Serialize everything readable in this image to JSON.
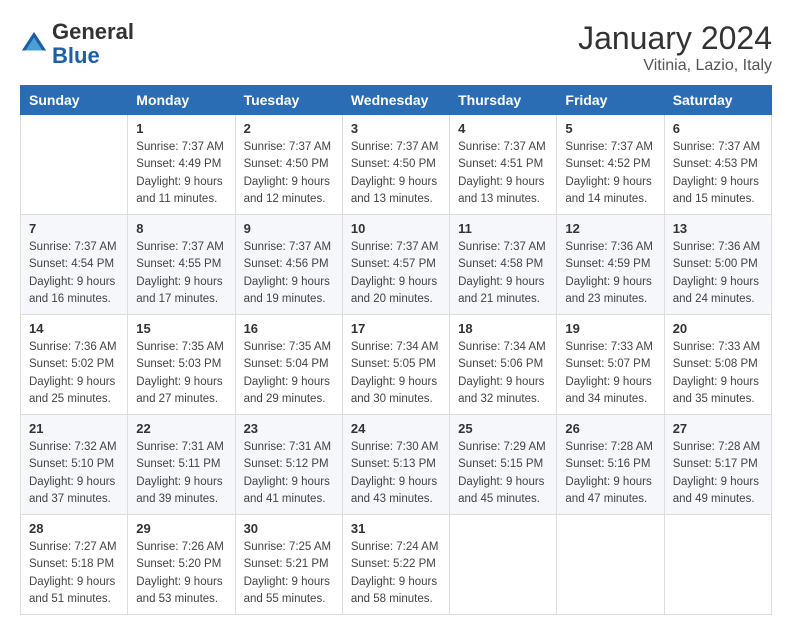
{
  "logo": {
    "general": "General",
    "blue": "Blue"
  },
  "title": "January 2024",
  "location": "Vitinia, Lazio, Italy",
  "days_of_week": [
    "Sunday",
    "Monday",
    "Tuesday",
    "Wednesday",
    "Thursday",
    "Friday",
    "Saturday"
  ],
  "weeks": [
    [
      {
        "day": "",
        "info": ""
      },
      {
        "day": "1",
        "info": "Sunrise: 7:37 AM\nSunset: 4:49 PM\nDaylight: 9 hours\nand 11 minutes."
      },
      {
        "day": "2",
        "info": "Sunrise: 7:37 AM\nSunset: 4:50 PM\nDaylight: 9 hours\nand 12 minutes."
      },
      {
        "day": "3",
        "info": "Sunrise: 7:37 AM\nSunset: 4:50 PM\nDaylight: 9 hours\nand 13 minutes."
      },
      {
        "day": "4",
        "info": "Sunrise: 7:37 AM\nSunset: 4:51 PM\nDaylight: 9 hours\nand 13 minutes."
      },
      {
        "day": "5",
        "info": "Sunrise: 7:37 AM\nSunset: 4:52 PM\nDaylight: 9 hours\nand 14 minutes."
      },
      {
        "day": "6",
        "info": "Sunrise: 7:37 AM\nSunset: 4:53 PM\nDaylight: 9 hours\nand 15 minutes."
      }
    ],
    [
      {
        "day": "7",
        "info": "Sunrise: 7:37 AM\nSunset: 4:54 PM\nDaylight: 9 hours\nand 16 minutes."
      },
      {
        "day": "8",
        "info": "Sunrise: 7:37 AM\nSunset: 4:55 PM\nDaylight: 9 hours\nand 17 minutes."
      },
      {
        "day": "9",
        "info": "Sunrise: 7:37 AM\nSunset: 4:56 PM\nDaylight: 9 hours\nand 19 minutes."
      },
      {
        "day": "10",
        "info": "Sunrise: 7:37 AM\nSunset: 4:57 PM\nDaylight: 9 hours\nand 20 minutes."
      },
      {
        "day": "11",
        "info": "Sunrise: 7:37 AM\nSunset: 4:58 PM\nDaylight: 9 hours\nand 21 minutes."
      },
      {
        "day": "12",
        "info": "Sunrise: 7:36 AM\nSunset: 4:59 PM\nDaylight: 9 hours\nand 23 minutes."
      },
      {
        "day": "13",
        "info": "Sunrise: 7:36 AM\nSunset: 5:00 PM\nDaylight: 9 hours\nand 24 minutes."
      }
    ],
    [
      {
        "day": "14",
        "info": "Sunrise: 7:36 AM\nSunset: 5:02 PM\nDaylight: 9 hours\nand 25 minutes."
      },
      {
        "day": "15",
        "info": "Sunrise: 7:35 AM\nSunset: 5:03 PM\nDaylight: 9 hours\nand 27 minutes."
      },
      {
        "day": "16",
        "info": "Sunrise: 7:35 AM\nSunset: 5:04 PM\nDaylight: 9 hours\nand 29 minutes."
      },
      {
        "day": "17",
        "info": "Sunrise: 7:34 AM\nSunset: 5:05 PM\nDaylight: 9 hours\nand 30 minutes."
      },
      {
        "day": "18",
        "info": "Sunrise: 7:34 AM\nSunset: 5:06 PM\nDaylight: 9 hours\nand 32 minutes."
      },
      {
        "day": "19",
        "info": "Sunrise: 7:33 AM\nSunset: 5:07 PM\nDaylight: 9 hours\nand 34 minutes."
      },
      {
        "day": "20",
        "info": "Sunrise: 7:33 AM\nSunset: 5:08 PM\nDaylight: 9 hours\nand 35 minutes."
      }
    ],
    [
      {
        "day": "21",
        "info": "Sunrise: 7:32 AM\nSunset: 5:10 PM\nDaylight: 9 hours\nand 37 minutes."
      },
      {
        "day": "22",
        "info": "Sunrise: 7:31 AM\nSunset: 5:11 PM\nDaylight: 9 hours\nand 39 minutes."
      },
      {
        "day": "23",
        "info": "Sunrise: 7:31 AM\nSunset: 5:12 PM\nDaylight: 9 hours\nand 41 minutes."
      },
      {
        "day": "24",
        "info": "Sunrise: 7:30 AM\nSunset: 5:13 PM\nDaylight: 9 hours\nand 43 minutes."
      },
      {
        "day": "25",
        "info": "Sunrise: 7:29 AM\nSunset: 5:15 PM\nDaylight: 9 hours\nand 45 minutes."
      },
      {
        "day": "26",
        "info": "Sunrise: 7:28 AM\nSunset: 5:16 PM\nDaylight: 9 hours\nand 47 minutes."
      },
      {
        "day": "27",
        "info": "Sunrise: 7:28 AM\nSunset: 5:17 PM\nDaylight: 9 hours\nand 49 minutes."
      }
    ],
    [
      {
        "day": "28",
        "info": "Sunrise: 7:27 AM\nSunset: 5:18 PM\nDaylight: 9 hours\nand 51 minutes."
      },
      {
        "day": "29",
        "info": "Sunrise: 7:26 AM\nSunset: 5:20 PM\nDaylight: 9 hours\nand 53 minutes."
      },
      {
        "day": "30",
        "info": "Sunrise: 7:25 AM\nSunset: 5:21 PM\nDaylight: 9 hours\nand 55 minutes."
      },
      {
        "day": "31",
        "info": "Sunrise: 7:24 AM\nSunset: 5:22 PM\nDaylight: 9 hours\nand 58 minutes."
      },
      {
        "day": "",
        "info": ""
      },
      {
        "day": "",
        "info": ""
      },
      {
        "day": "",
        "info": ""
      }
    ]
  ]
}
